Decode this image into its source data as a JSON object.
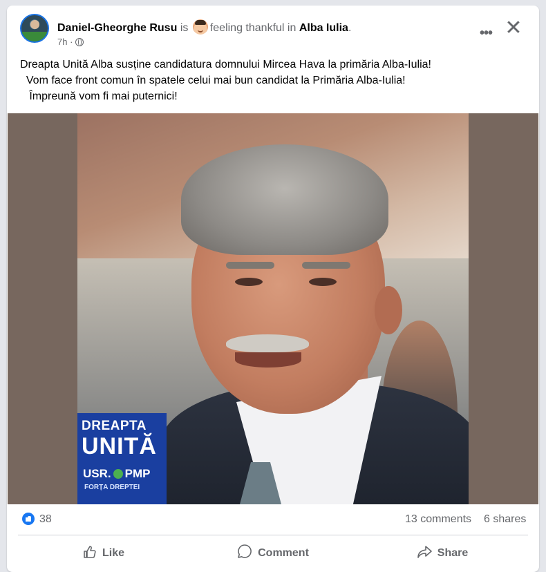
{
  "post": {
    "author": "Daniel-Gheorghe Rusu",
    "is_word": "is",
    "feeling_text": "feeling thankful in",
    "location": "Alba Iulia",
    "location_suffix": ".",
    "time": "7h",
    "time_separator": "·",
    "body_lines": [
      "Dreapta Unită Alba susține candidatura domnului Mircea Hava la primăria Alba-Iulia!",
      "  Vom face front comun în spatele celui mai bun candidat la Primăria Alba-Iulia!",
      "   Împreună vom fi mai puternici!"
    ],
    "more_label": "•••",
    "close_label": "✕"
  },
  "image": {
    "logo_line1": "DREAPTA",
    "logo_line2": "UNITĂ",
    "logo_usr": "USR.",
    "logo_pmp": "PMP",
    "logo_line4": "FORȚA DREPTEI",
    "background_color": "#77675e",
    "logo_color": "#1a3fa0"
  },
  "stats": {
    "reactions": "38",
    "comments": "13 comments",
    "shares": "6 shares"
  },
  "actions": {
    "like": "Like",
    "comment": "Comment",
    "share": "Share"
  },
  "colors": {
    "accent": "#1877f2",
    "muted_text": "#65676b",
    "card_bg": "#ffffff",
    "page_bg": "#e4e6eb"
  }
}
